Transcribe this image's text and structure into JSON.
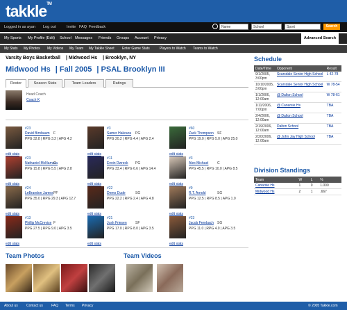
{
  "brand": {
    "logo": "takkle",
    "tm": "TM"
  },
  "topbar": {
    "logged_in": "Logged in as ayan",
    "logout": "Log out",
    "links": [
      "Invite",
      "FAQ",
      "Feedback"
    ]
  },
  "search": {
    "query": "Name",
    "category": "School",
    "subtype": "Sport",
    "button": "Search"
  },
  "mainnav": {
    "items": [
      "My Sports",
      "My Profile (Edit)",
      "School",
      "Messages",
      "Friends",
      "Groups",
      "Account",
      "Privacy"
    ],
    "advanced": "Advanced Search"
  },
  "subnav": {
    "items": [
      "My Stats",
      "My Photos",
      "My Videos",
      "My Team",
      "My Takkle Sheet",
      "Enter Game Stats",
      "Players to Watch",
      "Teams to Watch"
    ]
  },
  "team": {
    "sport": "Varsity Boys Basketball",
    "school": "Midwood Hs",
    "location": "Brooklyn, NY",
    "season_school": "Midwood Hs",
    "season": "Fall 2005",
    "league": "PSAL Brooklyn III"
  },
  "tabs": [
    "Roster",
    "Season Stats",
    "Team Leaders",
    "Ratings"
  ],
  "coach": {
    "label": "Head Coach",
    "name": "Coach K"
  },
  "edit_label": "edit stats",
  "players": [
    {
      "num": "#23",
      "name": "David Birnbaum",
      "pos": "F",
      "stats": "PPG 32.8 | RPG 3.2 | APG 4.2"
    },
    {
      "num": "#3",
      "name": "Samer Hakoura",
      "pos": "PG",
      "stats": "PPG 20.2 | RPG 4.4 | APG 2.4"
    },
    {
      "num": "#60",
      "name": "Zack Thompson",
      "pos": "SF",
      "stats": "PPG 19.0 | RPG 5.0 | APG 25.0"
    },
    {
      "num": "#23",
      "name": "Nathaniel McNamara",
      "pos": "C",
      "stats": "PPG 15.8 | RPG 5.5 | APG 2.8"
    },
    {
      "num": "#11",
      "name": "Erwin Dwreck",
      "pos": "PG",
      "stats": "PPG 33.4 | RPG 6.6 | APG 14.4"
    },
    {
      "num": "#3",
      "name": "Alex Michael",
      "pos": "C",
      "stats": "PPG 45.5 | RPG 10.0 | APG 8.5"
    },
    {
      "num": "#24",
      "name": "LeBrandon James",
      "pos": "PF",
      "stats": "PPG 35.0 | RPG 29.3 | APG 12.7"
    },
    {
      "num": "#22",
      "name": "Demo Dude",
      "pos": "SG",
      "stats": "PPG 22.2 | RPG 2.4 | APG 4.8"
    },
    {
      "num": "#9",
      "name": "R.T. Arnold",
      "pos": "SG",
      "stats": "PPG 12.5 | RPG 8.5 | APG 1.0"
    },
    {
      "num": "#13",
      "name": "Phillip McCrevice",
      "pos": "F",
      "stats": "PPG 27.5 | RPG 9.0 | APG 3.5"
    },
    {
      "num": "#21",
      "name": "Josh Friesen",
      "pos": "SF",
      "stats": "PPG 17.0 | RPG 8.0 | APG 3.5"
    },
    {
      "num": "#23",
      "name": "Jacob Fernbach",
      "pos": "SG",
      "stats": "PPG 11.0 | RPG 4.0 | APG 3.5"
    }
  ],
  "media": {
    "photos": "Team Photos",
    "videos": "Team Videos"
  },
  "schedule": {
    "title": "Schedule",
    "headers": [
      "Date/Time",
      "Opponent",
      "Result"
    ],
    "rows": [
      {
        "d1": "9/1/2005,",
        "d2": "3:00pm",
        "opp": "Scarsdale Senior High School",
        "res": "L 42-78"
      },
      {
        "d1": "10/10/2005,",
        "d2": "3:00pm",
        "opp": "Scarsdale Senior High School",
        "res": "W 78-54"
      },
      {
        "d1": "1/1/2006,",
        "d2": "12:00am",
        "opp": "@ Dalton School",
        "res": "W 78-61"
      },
      {
        "d1": "1/11/2006,",
        "d2": "7:00pm",
        "opp": "@ Canarsie Hs",
        "res": "TBA"
      },
      {
        "d1": "2/4/2006,",
        "d2": "12:00am",
        "opp": "@ Dalton School",
        "res": "TBA"
      },
      {
        "d1": "2/19/2006,",
        "d2": "12:00am",
        "opp": "Dalton School",
        "res": "TBA"
      },
      {
        "d1": "2/20/2006,",
        "d2": "12:00am",
        "opp": "@ John Jay High School",
        "res": "TBA"
      }
    ]
  },
  "standings": {
    "title": "Division Standings",
    "headers": [
      "Team",
      "W",
      "L",
      "%"
    ],
    "rows": [
      {
        "team": "Canarsie Hs",
        "w": "1",
        "l": "0",
        "pct": "1.000"
      },
      {
        "team": "Midwood Hs",
        "w": "2",
        "l": "1",
        "pct": ".667"
      }
    ]
  },
  "footer": {
    "links": [
      "About us",
      "Contact us",
      "FAQ",
      "Terms",
      "Privacy"
    ],
    "copyright": "© 2005 Takkle.com"
  }
}
